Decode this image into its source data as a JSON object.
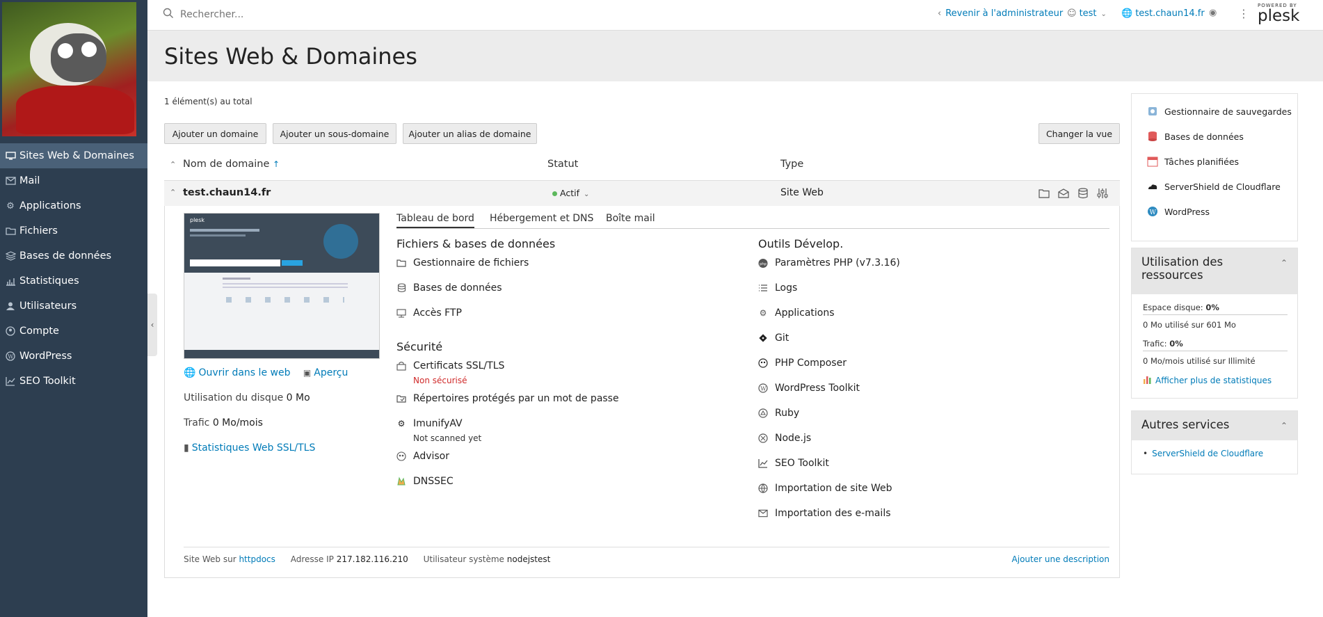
{
  "sidebar": {
    "items": [
      {
        "label": "Sites Web & Domaines",
        "icon": "monitor-icon",
        "active": true
      },
      {
        "label": "Mail",
        "icon": "mail-icon"
      },
      {
        "label": "Applications",
        "icon": "gear-icon"
      },
      {
        "label": "Fichiers",
        "icon": "folder-icon"
      },
      {
        "label": "Bases de données",
        "icon": "layers-icon"
      },
      {
        "label": "Statistiques",
        "icon": "bar-chart-icon"
      },
      {
        "label": "Utilisateurs",
        "icon": "user-icon"
      },
      {
        "label": "Compte",
        "icon": "person-circle-icon"
      },
      {
        "label": "WordPress",
        "icon": "wordpress-icon"
      },
      {
        "label": "SEO Toolkit",
        "icon": "seo-chart-icon"
      }
    ]
  },
  "topbar": {
    "search_placeholder": "Rechercher...",
    "back_admin": "Revenir à l'administrateur",
    "user": "test",
    "domain": "test.chaun14.fr",
    "powered_by": "POWERED BY",
    "brand": "plesk"
  },
  "header": {
    "title": "Sites Web & Domaines"
  },
  "list": {
    "count": "1 élément(s) au total",
    "buttons": {
      "add_domain": "Ajouter un domaine",
      "add_subdomain": "Ajouter un sous-domaine",
      "add_alias": "Ajouter un alias de domaine",
      "change_view": "Changer la vue"
    },
    "columns": {
      "name": "Nom de domaine",
      "sort_arrow": "↑",
      "status": "Statut",
      "type": "Type"
    },
    "row": {
      "domain": "test.chaun14.fr",
      "status": "Actif",
      "type": "Site Web"
    }
  },
  "panel": {
    "preview_links": {
      "open_web": "Ouvrir dans le web",
      "preview": "Aperçu"
    },
    "disk_label": "Utilisation du disque",
    "disk_value": "0 Mo",
    "traffic_label": "Trafic",
    "traffic_value": "0 Mo/mois",
    "stats_link": "Statistiques Web SSL/TLS",
    "thumb": {
      "brand": "plesk"
    },
    "tabs": [
      "Tableau de bord",
      "Hébergement et DNS",
      "Boîte mail"
    ],
    "files_section": {
      "title": "Fichiers & bases de données",
      "items": [
        "Gestionnaire de fichiers",
        "Bases de données",
        "Accès FTP"
      ]
    },
    "security_section": {
      "title": "Sécurité",
      "ssl": "Certificats SSL/TLS",
      "ssl_status": "Non sécurisé",
      "protected": "Répertoires protégés par un mot de passe",
      "imunify": "ImunifyAV",
      "imunify_status": "Not scanned yet",
      "advisor": "Advisor",
      "dnssec": "DNSSEC"
    },
    "dev_section": {
      "title": "Outils Dévelop.",
      "items": [
        "Paramètres PHP (v7.3.16)",
        "Logs",
        "Applications",
        "Git",
        "PHP Composer",
        "WordPress Toolkit",
        "Ruby",
        "Node.js",
        "SEO Toolkit",
        "Importation de site Web",
        "Importation des e-mails"
      ]
    },
    "footer": {
      "site_on_label": "Site Web sur",
      "site_on_value": "httpdocs",
      "ip_label": "Adresse IP",
      "ip_value": "217.182.116.210",
      "sysuser_label": "Utilisateur système",
      "sysuser_value": "nodejstest",
      "add_description": "Ajouter une description"
    }
  },
  "right": {
    "links": [
      "Gestionnaire de sauvegardes",
      "Bases de données",
      "Tâches planifiées",
      "ServerShield de Cloudflare",
      "WordPress"
    ],
    "resources": {
      "title_line1": "Utilisation des",
      "title_line2": "ressources",
      "disk_label": "Espace disque:",
      "disk_pct": "0%",
      "disk_detail": "0 Mo utilisé sur 601 Mo",
      "traffic_label": "Trafic:",
      "traffic_pct": "0%",
      "traffic_detail": "0 Mo/mois utilisé sur Illimité",
      "more_stats": "Afficher plus de statistiques"
    },
    "other": {
      "title": "Autres services",
      "item": "ServerShield de Cloudflare"
    }
  },
  "colors": {
    "accent": "#007bb8",
    "sidebar": "#2d3e50",
    "active_green": "#5cb85c",
    "danger": "#d02a2a"
  }
}
